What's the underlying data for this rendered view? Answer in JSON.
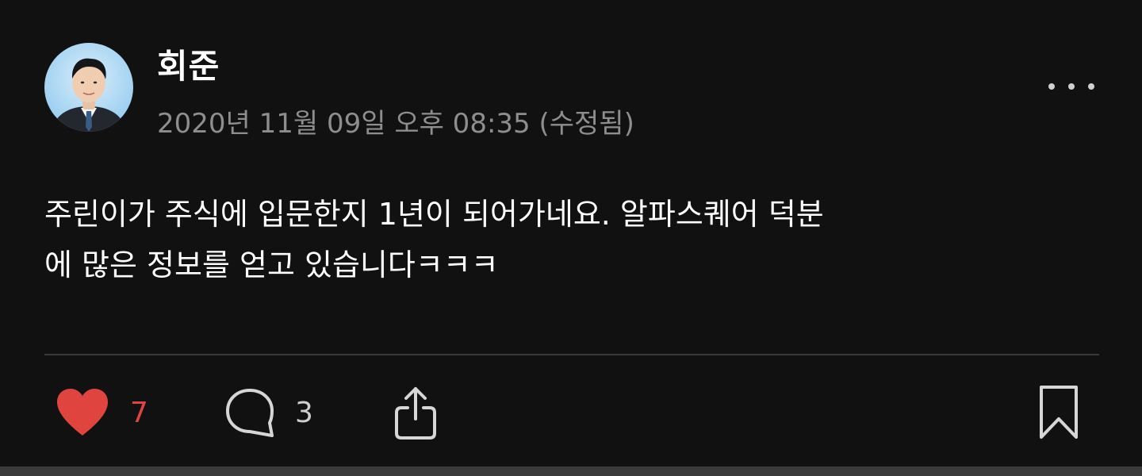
{
  "post": {
    "author": "회준",
    "timestamp": "2020년 11월 09일 오후 08:35 (수정됨)",
    "body": "주린이가 주식에 입문한지 1년이 되어가네요. 알파스퀘어 덕분\n에 많은 정보를 얻고 있습니다ㅋㅋㅋ",
    "avatar_icon": "profile-photo",
    "more_icon": "more-horizontal-icon"
  },
  "actions": {
    "like": {
      "icon": "heart-icon",
      "count": "7",
      "color": "#e0443e"
    },
    "comment": {
      "icon": "comment-bubble-icon",
      "count": "3"
    },
    "share": {
      "icon": "share-icon"
    },
    "bookmark": {
      "icon": "bookmark-icon"
    }
  },
  "colors": {
    "background": "#111111",
    "text": "#ffffff",
    "muted": "#8e8e8e",
    "accent_like": "#e0443e",
    "divider": "#3a3a3a"
  }
}
